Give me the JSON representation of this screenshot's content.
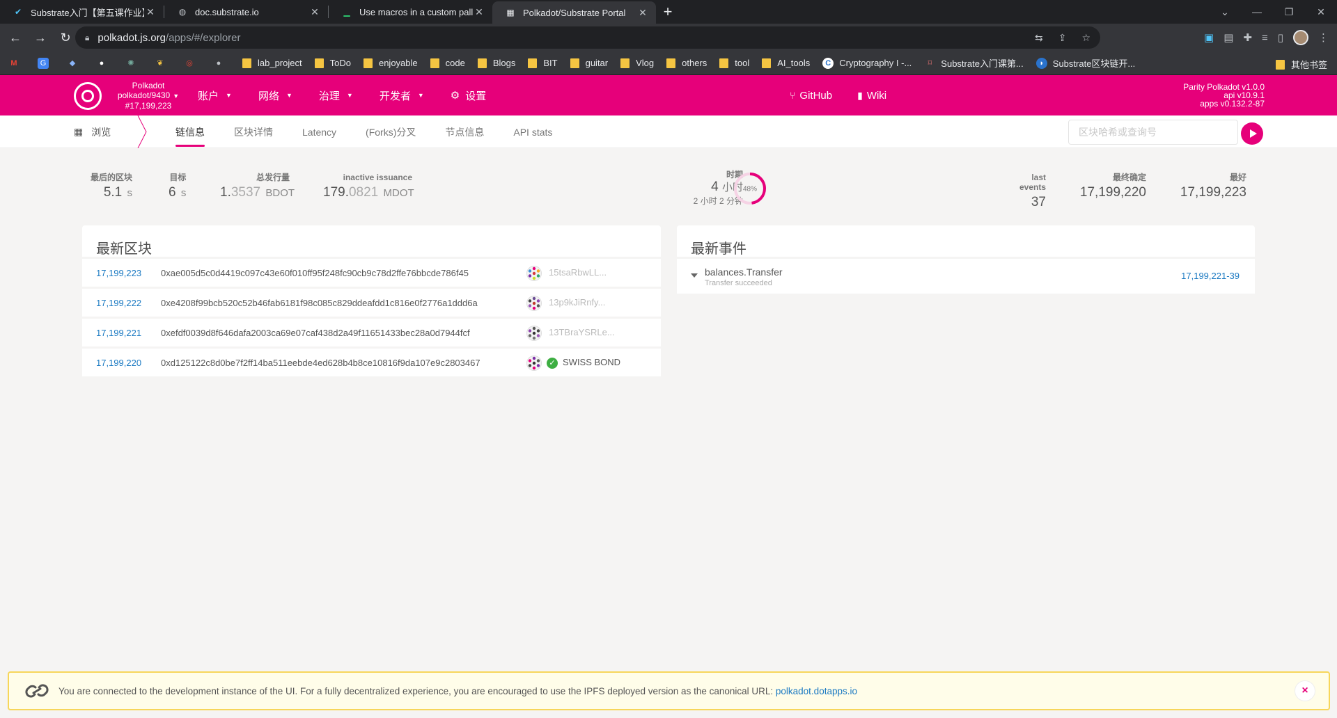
{
  "browser": {
    "tabs": [
      {
        "title": "Substrate入门【第五课作业】 -",
        "favicon": "check-icon",
        "active": false
      },
      {
        "title": "doc.substrate.io",
        "favicon": "globe-icon",
        "active": false
      },
      {
        "title": "Use macros in a custom pallet",
        "favicon": "terminal-icon",
        "active": false
      },
      {
        "title": "Polkadot/Substrate Portal",
        "favicon": "polkadot-icon",
        "active": true
      }
    ],
    "url_host": "polkadot.js.org",
    "url_path": "/apps/#/explorer",
    "bookmarks": [
      {
        "label": "",
        "icon": "gmail-icon"
      },
      {
        "label": "",
        "icon": "translate-icon"
      },
      {
        "label": "",
        "icon": "diamond-icon"
      },
      {
        "label": "",
        "icon": "github-icon"
      },
      {
        "label": "",
        "icon": "chatgpt-icon"
      },
      {
        "label": "",
        "icon": "leaf-icon"
      },
      {
        "label": "",
        "icon": "target-icon"
      },
      {
        "label": "",
        "icon": "apple-icon"
      },
      {
        "label": "lab_project",
        "icon": "folder"
      },
      {
        "label": "ToDo",
        "icon": "folder"
      },
      {
        "label": "enjoyable",
        "icon": "folder"
      },
      {
        "label": "code",
        "icon": "folder"
      },
      {
        "label": "Blogs",
        "icon": "folder"
      },
      {
        "label": "BIT",
        "icon": "folder"
      },
      {
        "label": "guitar",
        "icon": "folder"
      },
      {
        "label": "Vlog",
        "icon": "folder"
      },
      {
        "label": "others",
        "icon": "folder"
      },
      {
        "label": "tool",
        "icon": "folder"
      },
      {
        "label": "AI_tools",
        "icon": "folder"
      },
      {
        "label": "Cryptography I -...",
        "icon": "coursera-icon"
      },
      {
        "label": "Substrate入门课第...",
        "icon": "doc-icon"
      },
      {
        "label": "Substrate区块链开...",
        "icon": "web-icon"
      }
    ],
    "other_bookmarks": "其他书签"
  },
  "header": {
    "chain_name": "Polkadot",
    "chain_runtime": "polkadot/9430",
    "chain_block": "#17,199,223",
    "menu": [
      {
        "label": "账户",
        "has_caret": true
      },
      {
        "label": "网络",
        "has_caret": true
      },
      {
        "label": "治理",
        "has_caret": true
      },
      {
        "label": "开发者",
        "has_caret": true
      },
      {
        "label": "设置",
        "has_caret": false
      }
    ],
    "links": [
      {
        "label": "GitHub",
        "icon": "github-branch-icon"
      },
      {
        "label": "Wiki",
        "icon": "book-icon"
      }
    ],
    "version_line1": "Parity Polkadot v1.0.0",
    "version_line2": "api v10.9.1",
    "version_line3": "apps v0.132.2-87"
  },
  "subnav": {
    "browse": "浏览",
    "tabs": [
      {
        "label": "链信息",
        "active": true
      },
      {
        "label": "区块详情",
        "active": false
      },
      {
        "label": "Latency",
        "active": false
      },
      {
        "label": "(Forks)分叉",
        "active": false
      },
      {
        "label": "节点信息",
        "active": false
      },
      {
        "label": "API stats",
        "active": false
      }
    ],
    "search_placeholder": "区块哈希或查询号"
  },
  "summary": {
    "last_block": {
      "label": "最后的区块",
      "value": "5.1",
      "unit": "s"
    },
    "target": {
      "label": "目标",
      "value": "6",
      "unit": "s"
    },
    "total_issuance": {
      "label": "总发行量",
      "int": "1.",
      "dec": "3537",
      "unit": "BDOT"
    },
    "inactive_issuance": {
      "label": "inactive issuance",
      "int": "179.",
      "dec": "0821",
      "unit": "MDOT"
    },
    "epoch": {
      "label": "时期",
      "value": "4",
      "unit": "小时",
      "remaining": "2 小时 2 分钟",
      "percent_text": "48%",
      "percent": 0.48
    },
    "last_events": {
      "label": "last events",
      "value": "37"
    },
    "finalized": {
      "label": "最终确定",
      "value": "17,199,220"
    },
    "best": {
      "label": "最好",
      "value": "17,199,223"
    }
  },
  "blocks": {
    "title": "最新区块",
    "rows": [
      {
        "number": "17,199,223",
        "hash": "0xae005d5c0d4419c097c43e60f010ff95f248fc90cb9c78d2ffe76bbcde786f45",
        "author": "15tsaRbwLL...",
        "named": false
      },
      {
        "number": "17,199,222",
        "hash": "0xe4208f99bcb520c52b46fab6181f98c085c829ddeafdd1c816e0f2776a1ddd6a",
        "author": "13p9kJiRnfy...",
        "named": false
      },
      {
        "number": "17,199,221",
        "hash": "0xefdf0039d8f646dafa2003ca69e07caf438d2a49f11651433bec28a0d7944fcf",
        "author": "13TBraYSRLe...",
        "named": false
      },
      {
        "number": "17,199,220",
        "hash": "0xd125122c8d0be7f2ff14ba511eebde4ed628b4b8ce10816f9da107e9c2803467",
        "author": "SWISS BOND",
        "named": true
      }
    ]
  },
  "events": {
    "title": "最新事件",
    "rows": [
      {
        "name": "balances.Transfer",
        "desc": "Transfer succeeded",
        "ref": "17,199,221-39"
      }
    ]
  },
  "notice": {
    "message": "You are connected to the development instance of the UI. For a fully decentralized experience, you are encouraged to use the IPFS deployed version as the canonical URL: ",
    "link": "polkadot.dotapps.io",
    "close": "×"
  },
  "colors": {
    "brand": "#e6007a",
    "link": "#1a79c2",
    "notice_border": "#f7d65a"
  }
}
